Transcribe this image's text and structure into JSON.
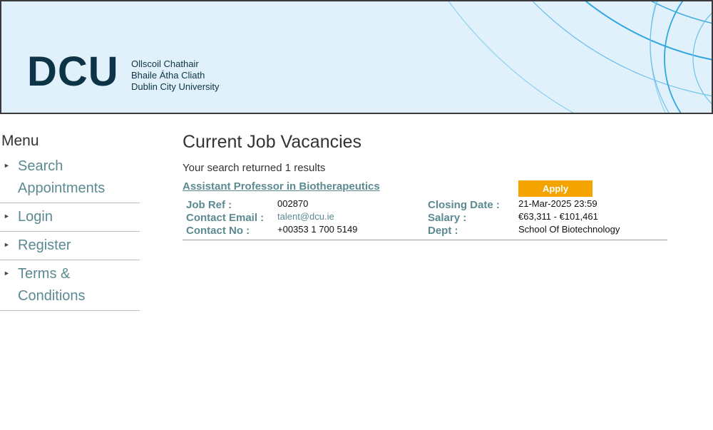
{
  "header": {
    "logo_text": "DCU",
    "logo_lines": [
      "Ollscoil Chathair",
      "Bhaile Átha Cliath",
      "Dublin City University"
    ]
  },
  "sidebar": {
    "title": "Menu",
    "items": [
      {
        "label": "Search Appointments"
      },
      {
        "label": "Login"
      },
      {
        "label": "Register"
      },
      {
        "label": "Terms & Conditions"
      }
    ]
  },
  "main": {
    "title": "Current Job Vacancies",
    "results_text": "Your search returned 1 results",
    "jobs": [
      {
        "title": "Assistant Professor in Biotherapeutics",
        "apply_label": "Apply",
        "job_ref_label": "Job Ref :",
        "job_ref": "002870",
        "contact_email_label": "Contact Email :",
        "contact_email": "talent@dcu.ie",
        "contact_no_label": "Contact No :",
        "contact_no": "+00353 1 700 5149",
        "closing_date_label": "Closing Date :",
        "closing_date": "21-Mar-2025 23:59",
        "salary_label": "Salary :",
        "salary": "€63,311 - €101,461",
        "dept_label": "Dept :",
        "dept": "School Of Biotechnology"
      }
    ]
  },
  "colors": {
    "header_bg": "#e1f1fb",
    "logo": "#0c3346",
    "link": "#5b8a91",
    "apply_button": "#f5a300"
  }
}
